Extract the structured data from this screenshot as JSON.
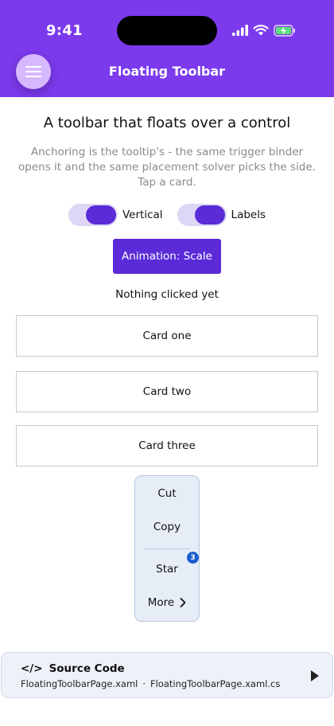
{
  "status_bar": {
    "time": "9:41"
  },
  "header": {
    "title": "Floating Toolbar",
    "menu_icon": "hamburger-icon",
    "accent": "#7c3aed"
  },
  "page": {
    "heading": "A toolbar that floats over a control",
    "description": "Anchoring is the tooltip's - the same trigger binder opens it and the same placement solver picks the side. Tap a card."
  },
  "toggles": [
    {
      "label": "Vertical",
      "on": true
    },
    {
      "label": "Labels",
      "on": true
    }
  ],
  "animation_button": {
    "label": "Animation: Scale"
  },
  "click_status": "Nothing clicked yet",
  "cards": [
    {
      "label": "Card one"
    },
    {
      "label": "Card two"
    },
    {
      "label": "Card three"
    }
  ],
  "toolbar": {
    "items": [
      {
        "label": "Cut"
      },
      {
        "label": "Copy"
      },
      {
        "label": "Star",
        "badge": "3"
      },
      {
        "label": "More",
        "icon": "chevron-right-icon"
      }
    ]
  },
  "source_panel": {
    "icon": "</>",
    "title": "Source Code",
    "files": [
      "FloatingToolbarPage.xaml",
      "·",
      "FloatingToolbarPage.xaml.cs"
    ],
    "play_icon": "play-icon"
  },
  "colors": {
    "primary_button": "#5b2bd8",
    "toggle_track": "#ddd6f5",
    "badge": "#1a5fd0"
  }
}
